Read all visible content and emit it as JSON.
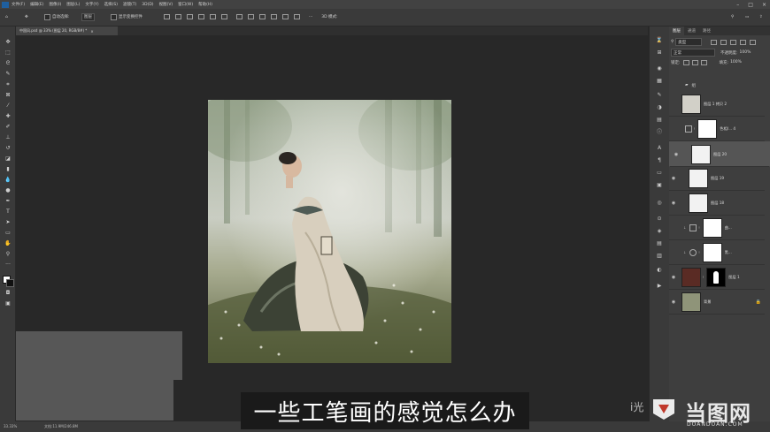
{
  "menubar": {
    "items": [
      "文件(F)",
      "编辑(E)",
      "图像(I)",
      "图层(L)",
      "文字(Y)",
      "选择(S)",
      "滤镜(T)",
      "3D(D)",
      "视图(V)",
      "窗口(W)",
      "帮助(H)"
    ]
  },
  "options": {
    "auto_select_label": "自动选择:",
    "auto_select_value": "图层",
    "show_transform_label": "显示变换控件",
    "mode_label": "3D 模式:"
  },
  "document": {
    "tab_title": "中国风.psd @ 33% (图层 20, RGB/8#) *"
  },
  "layers_panel": {
    "tabs": [
      "图层",
      "通道",
      "路径"
    ],
    "filter_label": "类型",
    "blend_mode": "正常",
    "opacity_label": "不透明度:",
    "opacity_value": "100%",
    "lock_label": "锁定:",
    "fill_label": "填充:",
    "fill_value": "100%",
    "group_name": "组",
    "layers": [
      {
        "name": "图层 1 拷贝 2"
      },
      {
        "name": "色相/... 4"
      },
      {
        "name": "图层 20"
      },
      {
        "name": "图层 19"
      },
      {
        "name": "图层 18"
      },
      {
        "name": "曲..."
      },
      {
        "name": "黑..."
      },
      {
        "name": "图层 1"
      },
      {
        "name": "背景"
      }
    ]
  },
  "status": {
    "zoom": "33.33%",
    "doc_size": "文档:11.9M/246.8M"
  },
  "subtitle": "一些工笔画的感觉怎么办",
  "watermark": {
    "left_text": "i光",
    "brand": "当图网",
    "domain": "DOANDOAN.COM"
  }
}
